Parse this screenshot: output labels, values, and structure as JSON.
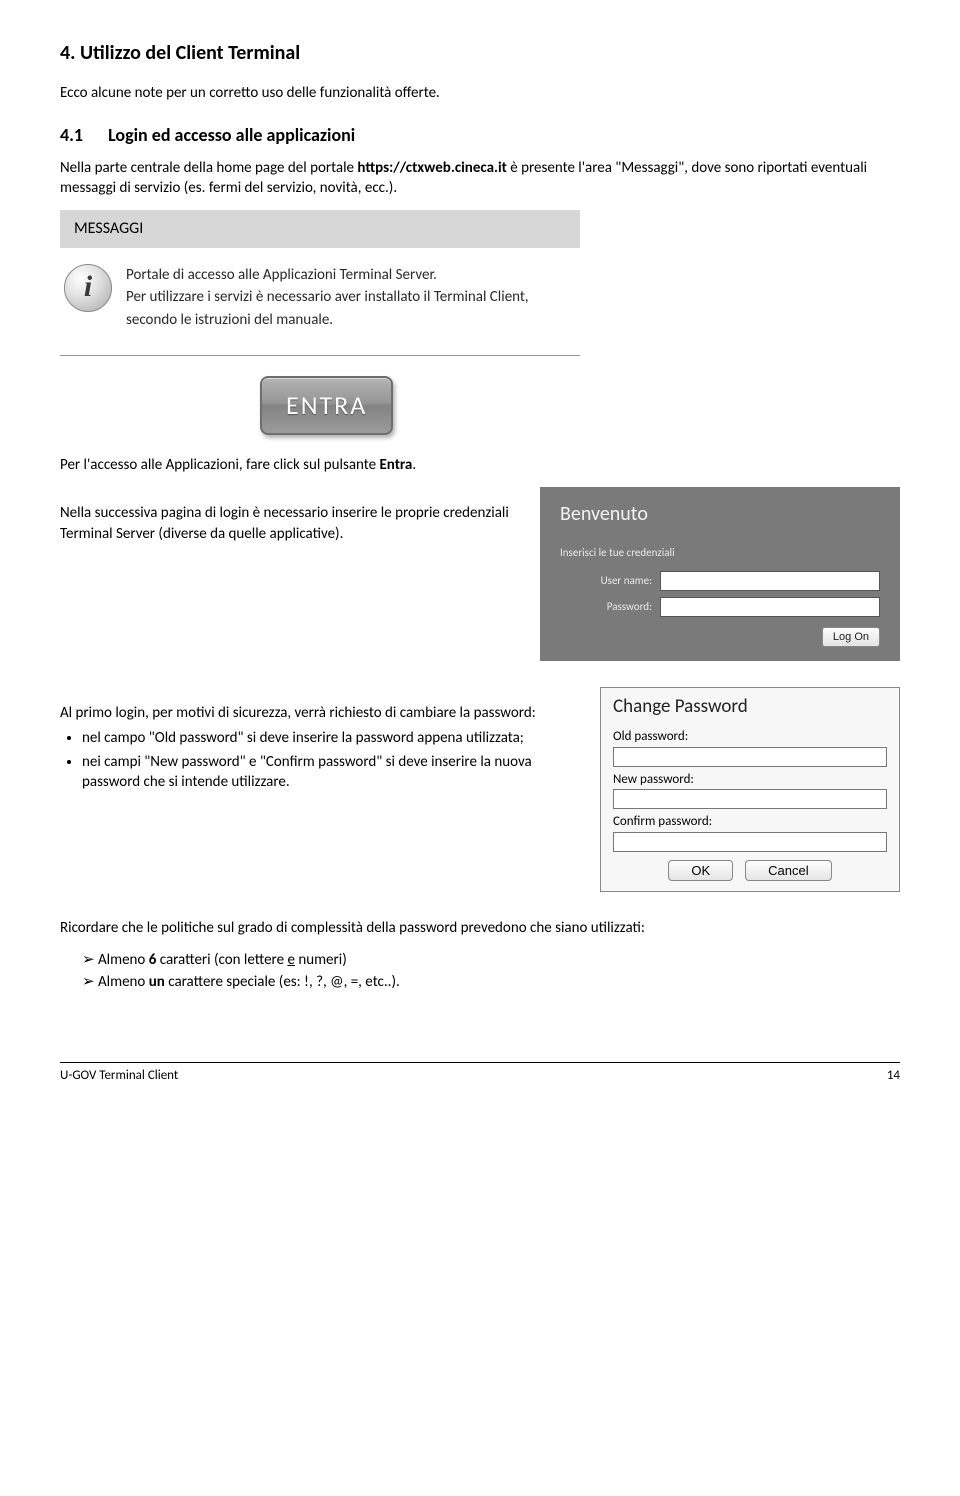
{
  "section": {
    "title": "4. Utilizzo del Client Terminal",
    "intro": "Ecco alcune note per un corretto uso delle funzionalità offerte.",
    "sub_num": "4.1",
    "sub_title": "Login ed accesso alle applicazioni",
    "p1_a": "Nella parte centrale della home page del portale ",
    "p1_url": "https://ctxweb.cineca.it",
    "p1_b": " è presente l'area \"Messaggi\", dove sono riportati eventuali messaggi di servizio (es. fermi del servizio, novità, ecc.)."
  },
  "messaggi": {
    "header": "MESSAGGI",
    "line1": "Portale di accesso alle Applicazioni Terminal Server.",
    "line2": "Per utilizzare i servizi è necessario aver installato il Terminal Client, secondo le istruzioni del manuale."
  },
  "entra": {
    "label": "ENTRA"
  },
  "p_entra_a": "Per l'accesso alle Applicazioni, fare click sul pulsante ",
  "p_entra_b": "Entra",
  "p_entra_c": ".",
  "login": {
    "text": "Nella successiva pagina di login è necessario inserire le proprie credenziali Terminal Server (diverse da quelle applicative).",
    "panel": {
      "welcome": "Benvenuto",
      "hint": "Inserisci le tue credenziali",
      "user_label": "User name:",
      "pass_label": "Password:",
      "logon": "Log On"
    }
  },
  "change": {
    "intro": "Al primo login, per motivi di sicurezza, verrà richiesto di cambiare la password:",
    "b1": "nel campo \"Old password\" si deve inserire la password appena utilizzata;",
    "b2": "nei campi \"New password\" e \"Confirm password\" si deve inserire la nuova password che si intende utilizzare.",
    "panel": {
      "title": "Change Password",
      "old": "Old password:",
      "new": "New password:",
      "confirm": "Confirm password:",
      "ok": "OK",
      "cancel": "Cancel"
    }
  },
  "policy": {
    "intro": "Ricordare che le politiche sul grado di complessità della password prevedono che siano utilizzati:",
    "a1_a": "Almeno ",
    "a1_b": "6",
    "a1_c": " caratteri (con lettere ",
    "a1_d": "e",
    "a1_e": " numeri)",
    "a2_a": "Almeno ",
    "a2_b": "un",
    "a2_c": " carattere speciale (es: !, ?, @, =, etc..)."
  },
  "footer": {
    "left": "U-GOV Terminal Client",
    "right": "14"
  }
}
